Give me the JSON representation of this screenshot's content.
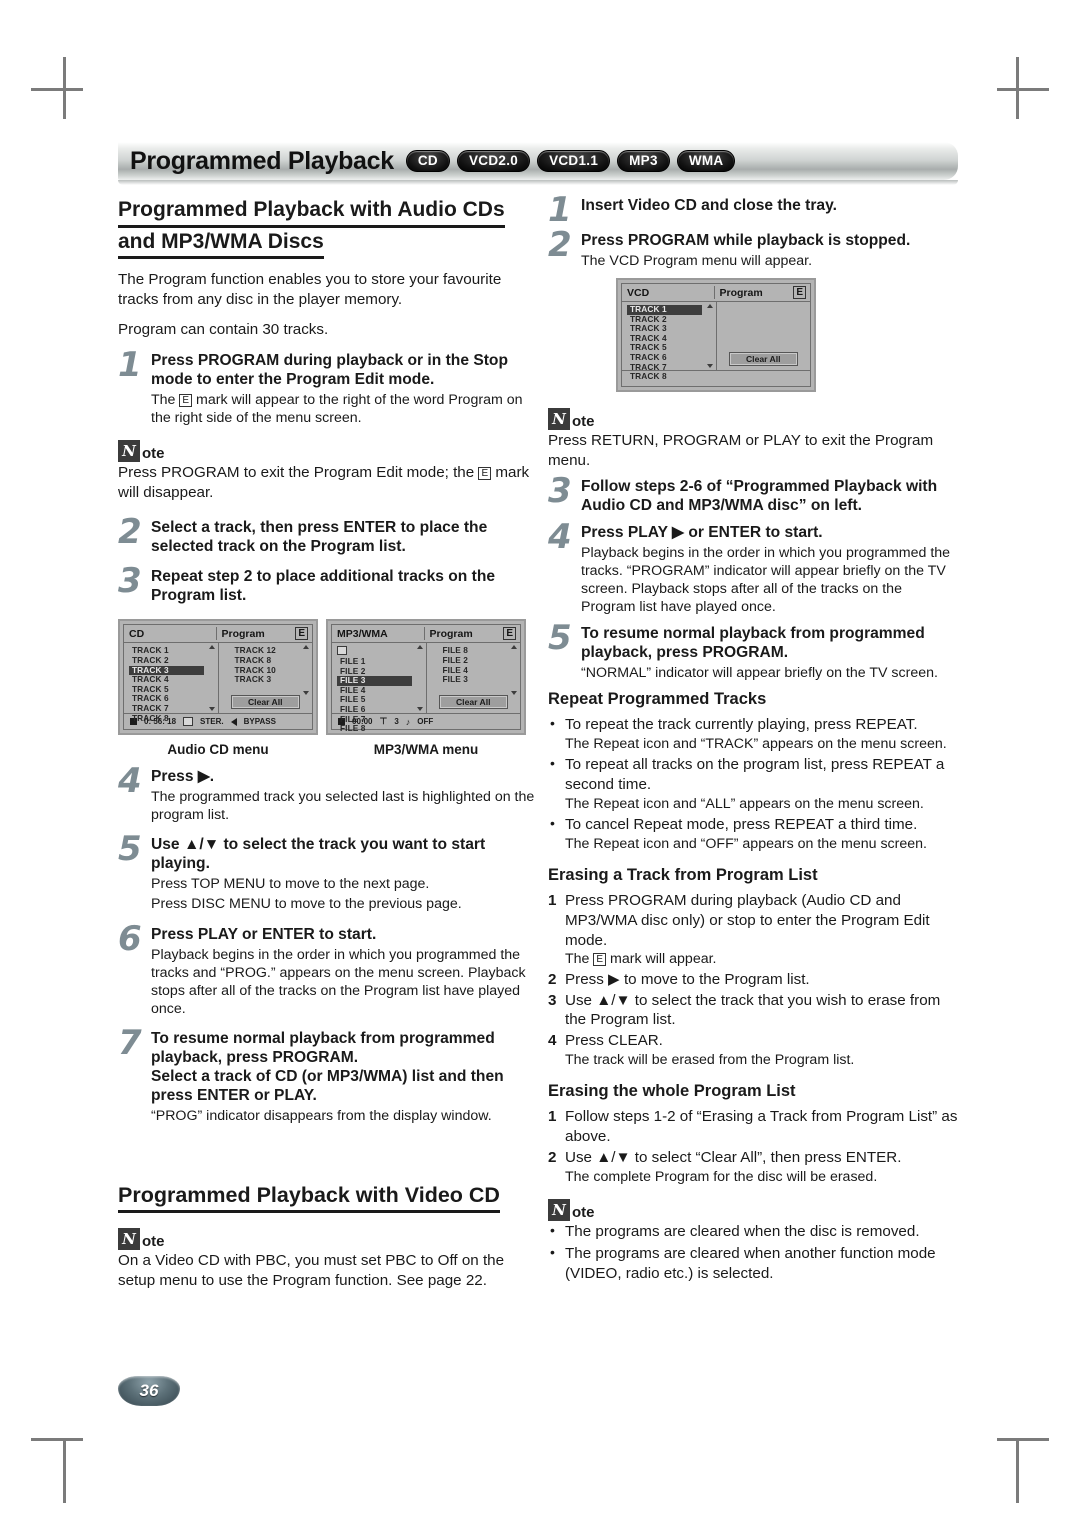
{
  "header": {
    "title": "Programmed Playback",
    "badges": [
      "CD",
      "VCD2.0",
      "VCD1.1",
      "MP3",
      "WMA"
    ]
  },
  "left": {
    "section_title_line1": "Programmed Playback with Audio CDs",
    "section_title_line2": "and MP3/WMA Discs",
    "intro1": "The Program function enables you to store your favourite tracks from any disc in the player memory.",
    "intro2": "Program can contain 30 tracks.",
    "step1": {
      "num": "1",
      "title": "Press PROGRAM during playback or in the Stop mode to enter the Program Edit mode.",
      "desc_a": "The",
      "desc_b": "mark will appear to the right of the word Program on the right side of the menu screen."
    },
    "note1": {
      "label": "ote",
      "mark": "N",
      "text_a": "Press PROGRAM to exit the Program Edit mode; the",
      "text_b": "mark will disappear."
    },
    "step2": {
      "num": "2",
      "title": "Select a track, then press ENTER to place the selected track on the Program list."
    },
    "step3": {
      "num": "3",
      "title": "Repeat step 2 to place additional tracks on the Program list."
    },
    "caption_cd": "Audio CD menu",
    "caption_mp3": "MP3/WMA menu",
    "step4": {
      "num": "4",
      "title": "Press ▶.",
      "desc": "The programmed track you selected last is highlighted on the program list."
    },
    "step5": {
      "num": "5",
      "title": "Use ▲/▼ to select the track you want to start playing.",
      "desc1": "Press TOP MENU to move to the next page.",
      "desc2": "Press DISC MENU to move to the previous page."
    },
    "step6": {
      "num": "6",
      "title": "Press PLAY or ENTER to start.",
      "desc": "Playback begins in the order in which you programmed the tracks and “PROG.” appears on the menu screen. Playback stops after all of the tracks on the Program list have played once."
    },
    "step7": {
      "num": "7",
      "title_a": "To resume normal playback from programmed playback, press PROGRAM.",
      "title_b": "Select a track of CD (or MP3/WMA) list and then press ENTER or PLAY.",
      "desc": "“PROG” indicator disappears from the display window."
    },
    "video_cd_title": "Programmed Playback with Video CD",
    "note2": {
      "label": "ote",
      "mark": "N",
      "text": "On a Video CD with PBC, you must set PBC to Off on the setup menu to use the Program function. See page 22."
    }
  },
  "right": {
    "step1": {
      "num": "1",
      "title": "Insert Video CD and close the tray."
    },
    "step2": {
      "num": "2",
      "title": "Press PROGRAM while playback is stopped.",
      "desc": "The VCD Program menu will appear."
    },
    "note1": {
      "label": "ote",
      "mark": "N",
      "text": "Press RETURN, PROGRAM or PLAY to exit the Program menu."
    },
    "step3": {
      "num": "3",
      "title": "Follow steps 2-6 of “Programmed Playback with Audio CD and MP3/WMA disc” on left."
    },
    "step4": {
      "num": "4",
      "title": "Press PLAY ▶ or ENTER to start.",
      "desc": "Playback begins in the order in which you programmed the tracks. “PROGRAM” indicator will appear briefly on the TV screen. Playback stops after all of the tracks on the Program list have played once."
    },
    "step5": {
      "num": "5",
      "title": "To resume normal playback from programmed playback, press PROGRAM.",
      "desc": "“NORMAL” indicator will appear briefly on the TV screen."
    },
    "repeat_heading": "Repeat Programmed Tracks",
    "repeat_items": [
      {
        "main": "To repeat the track currently playing, press REPEAT.",
        "sub": "The Repeat icon and “TRACK” appears on the menu screen."
      },
      {
        "main": "To repeat all tracks on the program list, press REPEAT a second time.",
        "sub": "The Repeat icon and “ALL” appears on the menu screen."
      },
      {
        "main": "To cancel Repeat mode, press REPEAT a third time.",
        "sub": "The Repeat icon and “OFF” appears on the menu screen."
      }
    ],
    "erase_track_heading": "Erasing a Track from Program List",
    "erase_track_steps": [
      {
        "n": "1",
        "main": "Press PROGRAM during playback (Audio CD and MP3/WMA disc only) or stop to enter the Program Edit mode.",
        "sub": ""
      },
      {
        "n": "",
        "main": "",
        "sub": ""
      },
      {
        "n": "2",
        "main": "Press ▶ to move to the Program list.",
        "sub": ""
      },
      {
        "n": "3",
        "main": "Use ▲/▼ to select the track that you wish to erase from the Program list.",
        "sub": ""
      },
      {
        "n": "4",
        "main": "Press CLEAR.",
        "sub": "The track will be erased from the Program list."
      }
    ],
    "erase_track_emark_line_a": "The",
    "erase_track_emark_line_b": "mark will appear.",
    "erase_all_heading": "Erasing the whole Program List",
    "erase_all_steps": [
      {
        "n": "1",
        "main": "Follow steps 1-2 of “Erasing a Track from Program List” as above.",
        "sub": ""
      },
      {
        "n": "2",
        "main": "Use ▲/▼ to select “Clear All”, then press ENTER.",
        "sub": "The complete Program for the disc will be erased."
      }
    ],
    "note2": {
      "label": "ote",
      "mark": "N",
      "items": [
        "The programs are cleared when the disc is removed.",
        "The programs are cleared when another function mode (VIDEO, radio etc.) is selected."
      ]
    }
  },
  "osd": {
    "vcd": {
      "left_title": "VCD",
      "right_title": "Program",
      "edit_mark": "E",
      "left_items": [
        "TRACK 1",
        "TRACK 2",
        "TRACK 3",
        "TRACK 4",
        "TRACK 5",
        "TRACK 6",
        "TRACK 7",
        "TRACK 8"
      ],
      "selected_index": 0,
      "right_items": [],
      "clear_all": "Clear All",
      "footer": []
    },
    "cd": {
      "left_title": "CD",
      "right_title": "Program",
      "edit_mark": "E",
      "left_items": [
        "TRACK 1",
        "TRACK 2",
        "TRACK 3",
        "TRACK 4",
        "TRACK 5",
        "TRACK 6",
        "TRACK 7",
        "TRACK 8"
      ],
      "selected_index": 2,
      "right_items": [
        "TRACK 12",
        "TRACK 8",
        "TRACK 10",
        "TRACK 3"
      ],
      "clear_all": "Clear All",
      "footer": [
        "0: 56: 18",
        "STER.",
        "BYPASS"
      ]
    },
    "mp3": {
      "left_title": "MP3/WMA",
      "right_title": "Program",
      "edit_mark": "E",
      "left_items": [
        "FILE 1",
        "FILE 2",
        "FILE 3",
        "FILE 4",
        "FILE 5",
        "FILE 6",
        "FILE 7",
        "FILE 8"
      ],
      "selected_index": 2,
      "right_items": [
        "FILE 8",
        "FILE 2",
        "FILE 4",
        "FILE 3"
      ],
      "clear_all": "Clear All",
      "footer": [
        "00:00",
        "3",
        "OFF"
      ]
    }
  },
  "page": {
    "number": "36"
  }
}
